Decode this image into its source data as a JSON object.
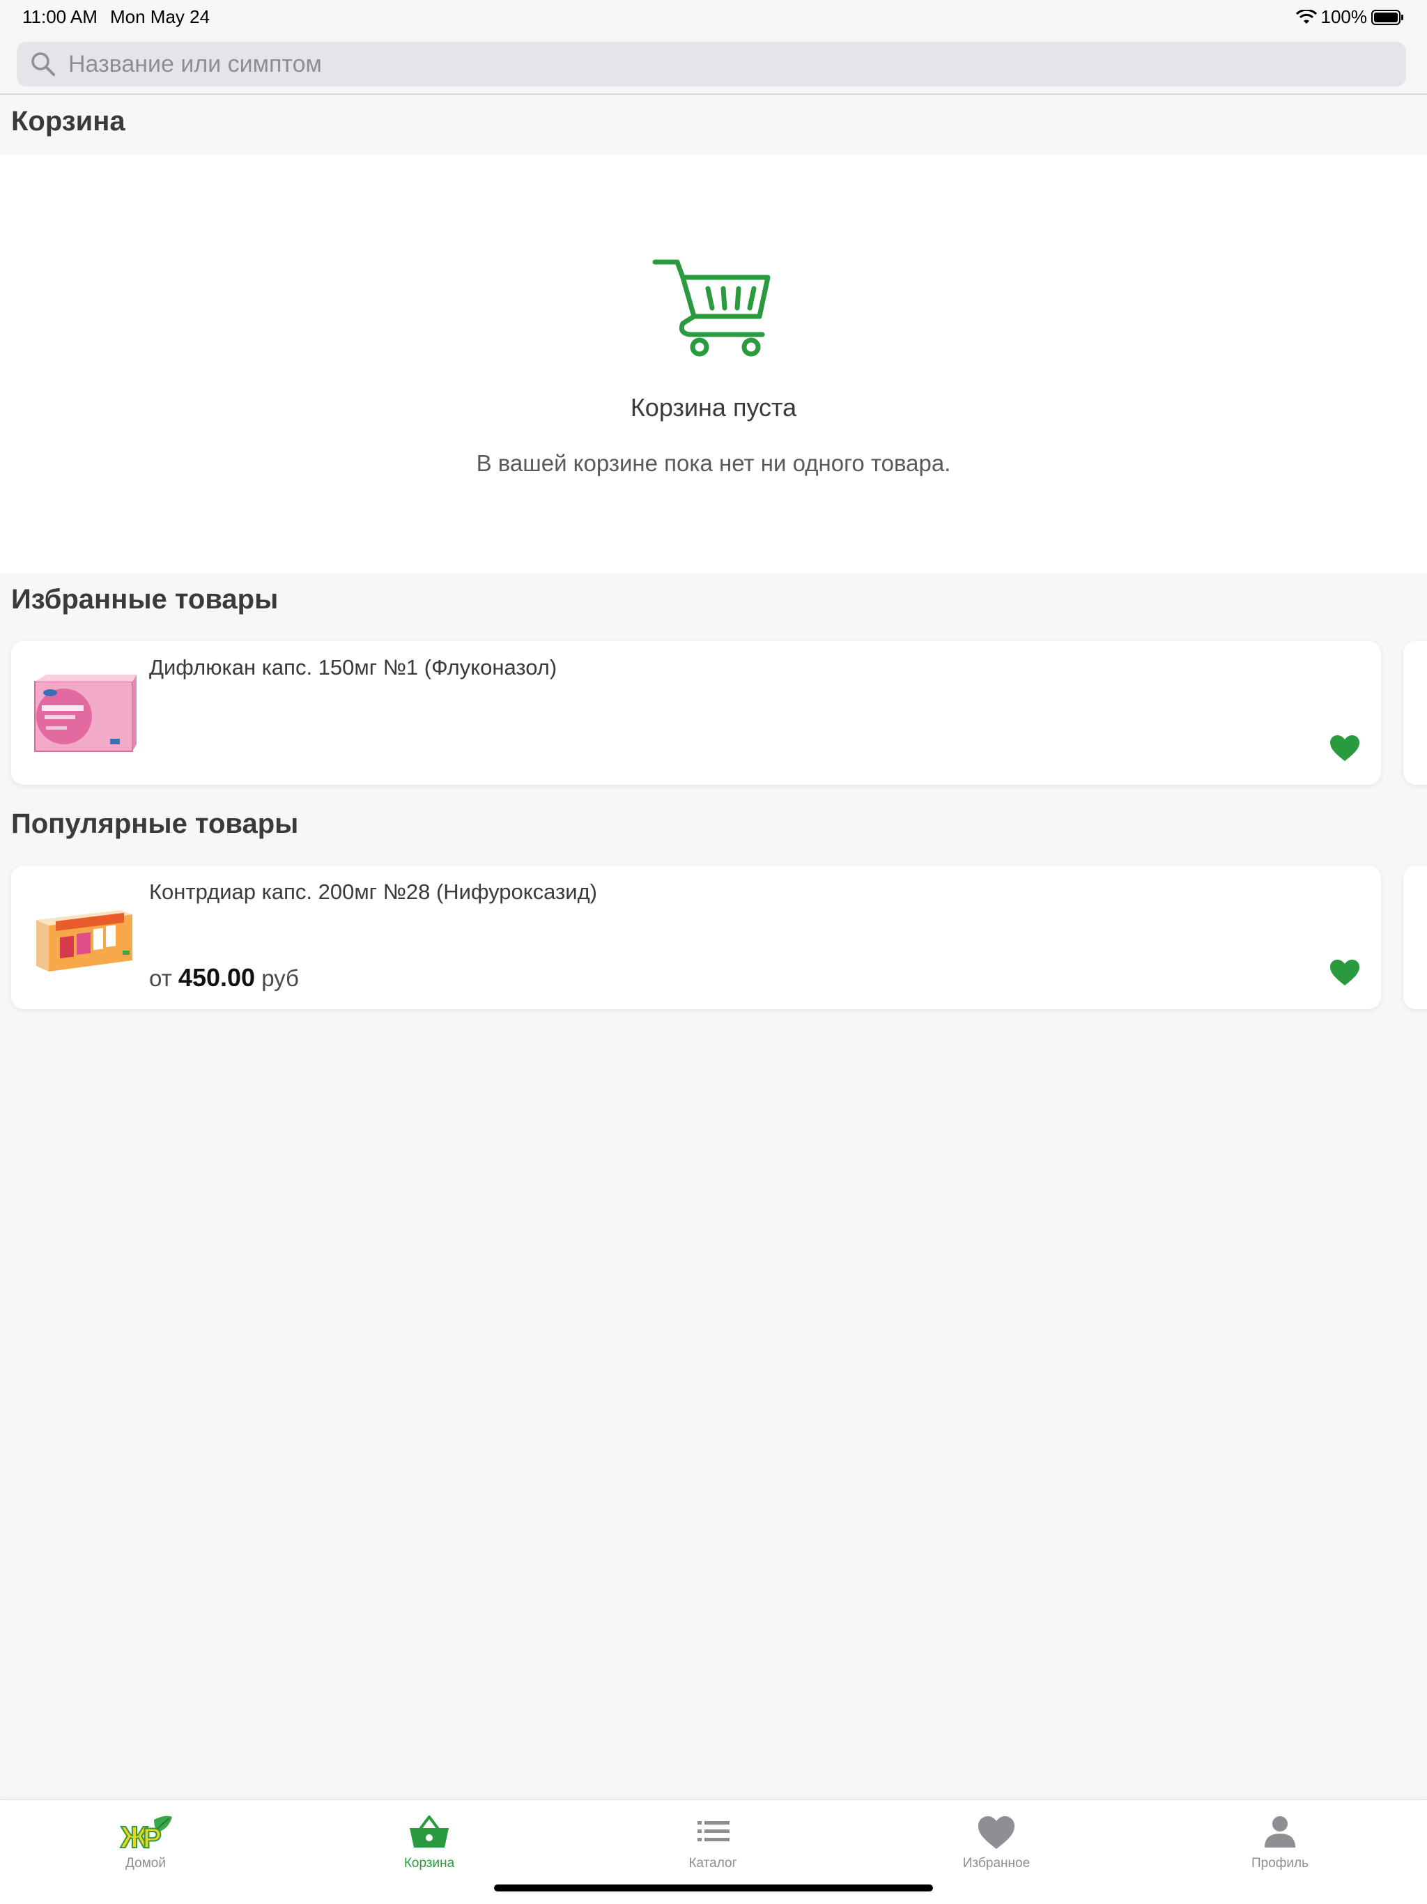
{
  "status_bar": {
    "time": "11:00 AM",
    "date": "Mon May 24",
    "battery": "100%"
  },
  "search": {
    "placeholder": "Название или симптом"
  },
  "cart": {
    "title": "Корзина",
    "empty_title": "Корзина пуста",
    "empty_text": "В вашей корзине пока нет ни одного товара."
  },
  "favorites": {
    "title": "Избранные товары",
    "items": [
      {
        "name": "Дифлюкан капс. 150мг №1 (Флуконазол)",
        "image": "diflucan-package",
        "favorited": true
      }
    ]
  },
  "popular": {
    "title": "Популярные товары",
    "items": [
      {
        "name": "Контрдиар капс. 200мг №28 (Нифуроксазид)",
        "price_prefix": "от",
        "price": "450.00",
        "currency": "руб",
        "image": "kontrdiar-package",
        "favorited": true
      }
    ]
  },
  "tabs": [
    {
      "label": "Домой",
      "icon": "home-logo-icon",
      "active": false
    },
    {
      "label": "Корзина",
      "icon": "basket-icon",
      "active": true
    },
    {
      "label": "Каталог",
      "icon": "list-icon",
      "active": false
    },
    {
      "label": "Избранное",
      "icon": "heart-icon",
      "active": false
    },
    {
      "label": "Профиль",
      "icon": "user-icon",
      "active": false
    }
  ],
  "colors": {
    "accent": "#2a9a3e",
    "background": "#f7f7f7",
    "inactive_tab": "#8e8e93"
  }
}
